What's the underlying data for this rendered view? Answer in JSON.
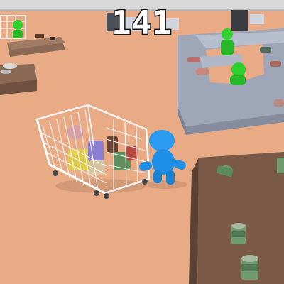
{
  "hud": {
    "money_label": "141"
  },
  "colors": {
    "floor": "#e9ab85",
    "player": "#1e8fe6",
    "shopper": "#2fd12f",
    "counter": "#9ea6b8",
    "table": "#7a5a46"
  },
  "icons": [
    "shopping-cart-icon",
    "player-character-icon",
    "shopper-icon",
    "can-icon"
  ]
}
